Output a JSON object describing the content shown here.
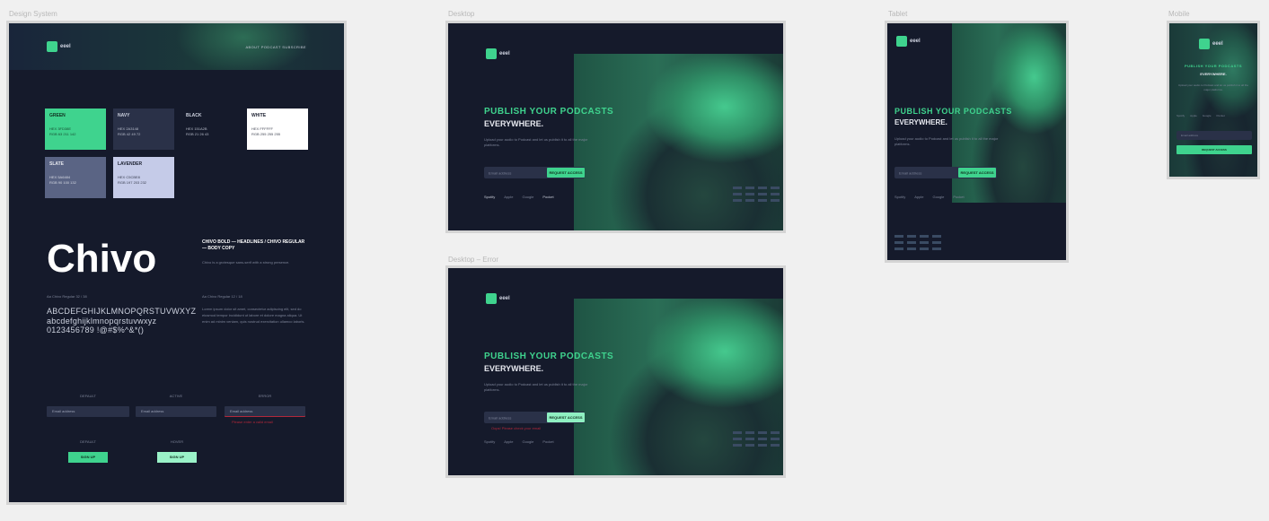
{
  "frames": {
    "design_system": {
      "label": "Design System",
      "logo_text": "eeel",
      "nav": "ABOUT   PODCAST   SUBSCRIBE",
      "swatches": [
        {
          "name": "GREEN",
          "rows": [
            "HEX  3FD38E",
            "RGB  63 211 142"
          ],
          "bg": "#3fd38e",
          "fg": "#10301f"
        },
        {
          "name": "NAVY",
          "rows": [
            "HEX  2A3148",
            "RGB  42 49 72"
          ],
          "bg": "#2a3148",
          "fg": "#cdd2df"
        },
        {
          "name": "BLACK",
          "rows": [
            "HEX  151A2B",
            "RGB  21 26 43"
          ],
          "bg": "#151a2b",
          "fg": "#cdd2df"
        },
        {
          "name": "WHITE",
          "rows": [
            "HEX  FFFFFF",
            "RGB  255 255 255"
          ],
          "bg": "#ffffff",
          "fg": "#1b2030"
        },
        {
          "name": "SLATE",
          "rows": [
            "HEX  5A6484",
            "RGB  90 100 132"
          ],
          "bg": "#5a6484",
          "fg": "#e6e8ef"
        },
        {
          "name": "LAVENDER",
          "rows": [
            "HEX  C5CBE8",
            "RGB  197 203 232"
          ],
          "bg": "#c5cbe8",
          "fg": "#1b2030"
        }
      ],
      "font_sample": "Chivo",
      "font_desc_bold": "CHIVO BOLD — HEADLINES / CHIVO REGULAR — BODY COPY",
      "font_desc": "Chivo is a grotesque sans-serif with a strong presence.",
      "meta_left": "Aa  Chivo Regular  32 / 38",
      "meta_right": "Aa  Chivo Regular  12 / 18",
      "alphabet": "ABCDEFGHIJKLMNOPQRSTUVWXYZ abcdefghijklmnopqrstuvwxyz 0123456789 !@#$%^&*()",
      "body_copy": "Lorem ipsum dolor sit amet, consectetur adipiscing elit, sed do eiusmod tempor incididunt ut labore et dolore magna aliqua. Ut enim ad minim veniam, quis nostrud exercitation ullamco laboris.",
      "field_labels": [
        "DEFAULT",
        "ACTIVE",
        "ERROR"
      ],
      "field_placeholders": [
        "Email address",
        "Email address",
        "Email address"
      ],
      "error_text": "Please enter a valid email",
      "button_labels": [
        "DEFAULT",
        "HOVER"
      ],
      "button_text": "SIGN UP"
    },
    "desktop": {
      "label": "Desktop",
      "logo_text": "eeel",
      "title": "PUBLISH YOUR PODCASTS",
      "subtitle": "EVERYWHERE.",
      "para": "Upload your audio to Podcast and let us publish it to all the major platforms.",
      "email_placeholder": "Email address",
      "cta": "REQUEST ACCESS",
      "platforms": [
        "Spotify",
        "Apple",
        "Google",
        "Pocket"
      ]
    },
    "desktop_error": {
      "label": "Desktop – Error",
      "logo_text": "eeel",
      "title": "PUBLISH YOUR PODCASTS",
      "subtitle": "EVERYWHERE.",
      "para": "Upload your audio to Podcast and let us publish it to all the major platforms.",
      "email_placeholder": "Email address",
      "cta": "REQUEST ACCESS",
      "error": "Oops! Please check your email",
      "platforms": [
        "Spotify",
        "Apple",
        "Google",
        "Pocket"
      ]
    },
    "tablet": {
      "label": "Tablet",
      "logo_text": "eeel",
      "title": "PUBLISH YOUR PODCASTS",
      "subtitle": "EVERYWHERE.",
      "para": "Upload your audio to Podcast and let us publish it to all the major platforms.",
      "email_placeholder": "Email address",
      "cta": "REQUEST ACCESS",
      "platforms": [
        "Spotify",
        "Apple",
        "Google",
        "Pocket"
      ]
    },
    "mobile": {
      "label": "Mobile",
      "logo_text": "eeel",
      "title": "PUBLISH YOUR PODCASTS",
      "subtitle": "EVERYWHERE.",
      "para": "Upload your audio to Podcast and let us publish it to all the major platforms.",
      "email_placeholder": "Email address",
      "cta": "REQUEST ACCESS",
      "platforms": [
        "Spotify",
        "Apple",
        "Google",
        "Pocket"
      ]
    }
  },
  "colors": {
    "accent": "#3fd38e",
    "background": "#151a2b",
    "input": "#2a3148",
    "error": "#b2283a"
  }
}
